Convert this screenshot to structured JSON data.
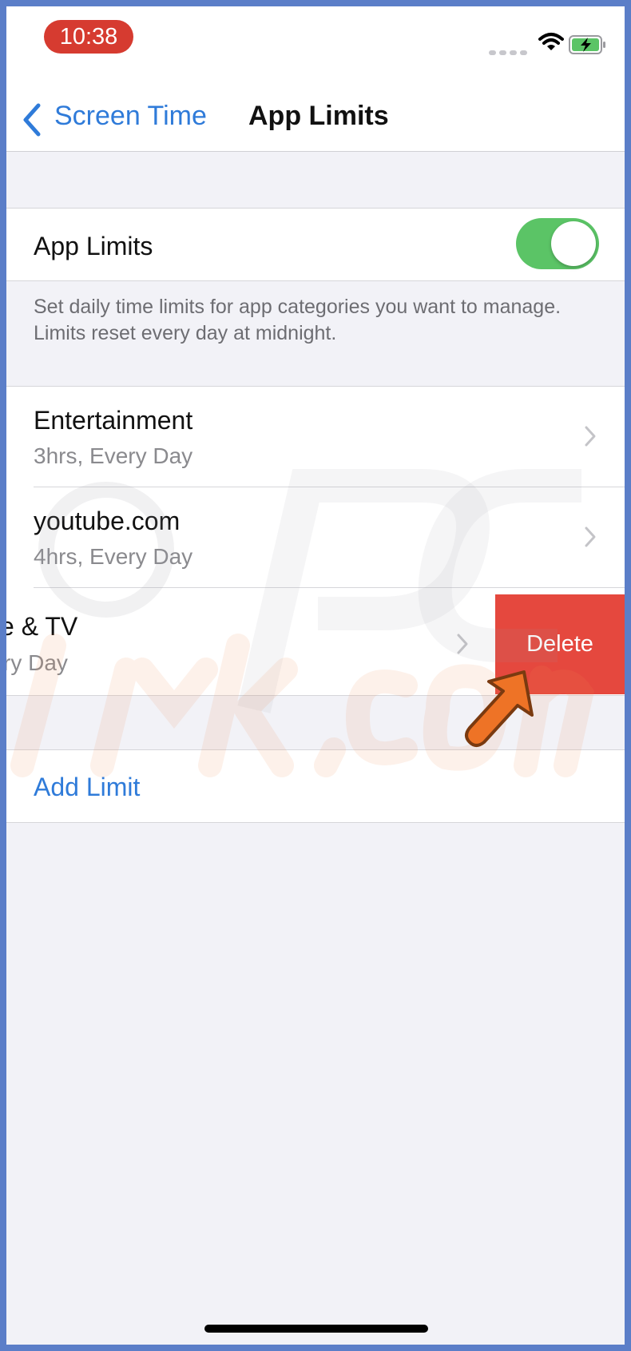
{
  "status_bar": {
    "time": "10:38"
  },
  "nav": {
    "back_label": "Screen Time",
    "title": "App Limits"
  },
  "app_limits_toggle": {
    "label": "App Limits",
    "on": true
  },
  "description": "Set daily time limits for app categories you want to manage. Limits reset every day at midnight.",
  "limits": [
    {
      "title": "Entertainment",
      "subtitle": "3hrs, Every Day"
    },
    {
      "title": "youtube.com",
      "subtitle": "4hrs, Every Day"
    },
    {
      "title": "e & TV",
      "subtitle": "ry Day"
    }
  ],
  "delete_label": "Delete",
  "add_limit_label": "Add Limit",
  "colors": {
    "accent": "#2f7bd9",
    "toggle_on": "#5bc466",
    "delete": "#e5483e",
    "time_pill": "#d63b30",
    "arrow": "#ee7326"
  },
  "icons": [
    "back-chevron-icon",
    "wifi-icon",
    "battery-charging-icon",
    "chevron-right-icon",
    "pointer-arrow-icon"
  ]
}
